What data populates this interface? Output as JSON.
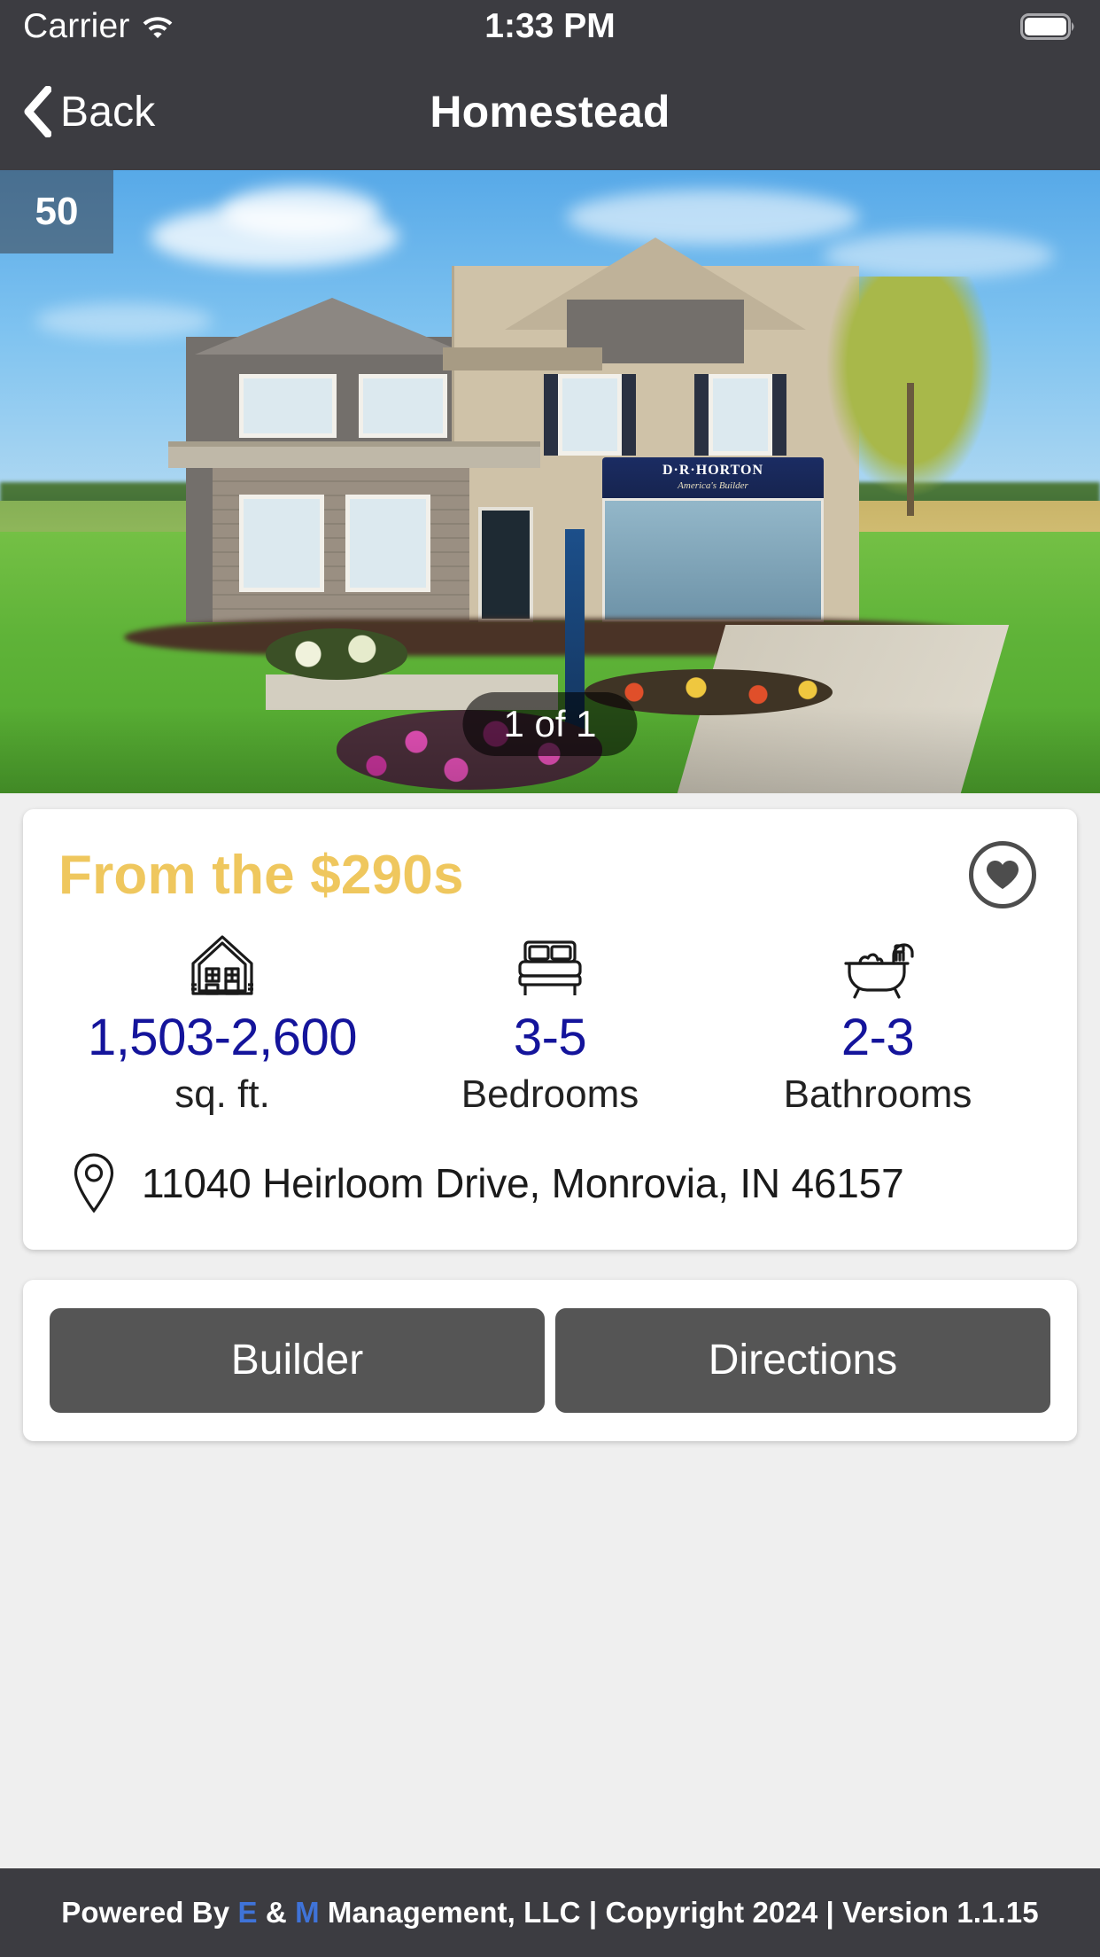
{
  "status_bar": {
    "carrier": "Carrier",
    "time": "1:33 PM",
    "wifi_icon": "wifi-icon",
    "battery_icon": "battery-full-icon"
  },
  "nav_bar": {
    "back_label": "Back",
    "back_icon": "chevron-left-icon",
    "title": "Homestead"
  },
  "hero": {
    "count_badge": "50",
    "pager": "1 of 1",
    "photo_alt": "Two-story model home exterior with D·R·HORTON awning, green lawn and flower beds",
    "awning_brand": "D·R·HORTON",
    "awning_tagline": "America's Builder"
  },
  "listing": {
    "price": "From the $290s",
    "favorite_icon": "heart-icon",
    "stats": [
      {
        "icon": "house-icon",
        "value": "1,503-2,600",
        "label": "sq. ft."
      },
      {
        "icon": "bed-icon",
        "value": "3-5",
        "label": "Bedrooms"
      },
      {
        "icon": "bathtub-icon",
        "value": "2-3",
        "label": "Bathrooms"
      }
    ],
    "address_icon": "map-pin-icon",
    "address": "11040 Heirloom Drive, Monrovia, IN 46157"
  },
  "actions": {
    "builder_label": "Builder",
    "directions_label": "Directions"
  },
  "footer": {
    "prefix": "Powered By ",
    "accent_e": "E",
    "amp": " & ",
    "accent_m": "M",
    "suffix": " Management, LLC | Copyright 2024 | Version 1.1.15"
  },
  "colors": {
    "chrome": "#3C3C41",
    "price_gold": "#EFC75E",
    "stat_navy": "#14149B",
    "button_gray": "#555555",
    "page_bg": "#EFEFEF",
    "footer_accent": "#3F73D8"
  }
}
